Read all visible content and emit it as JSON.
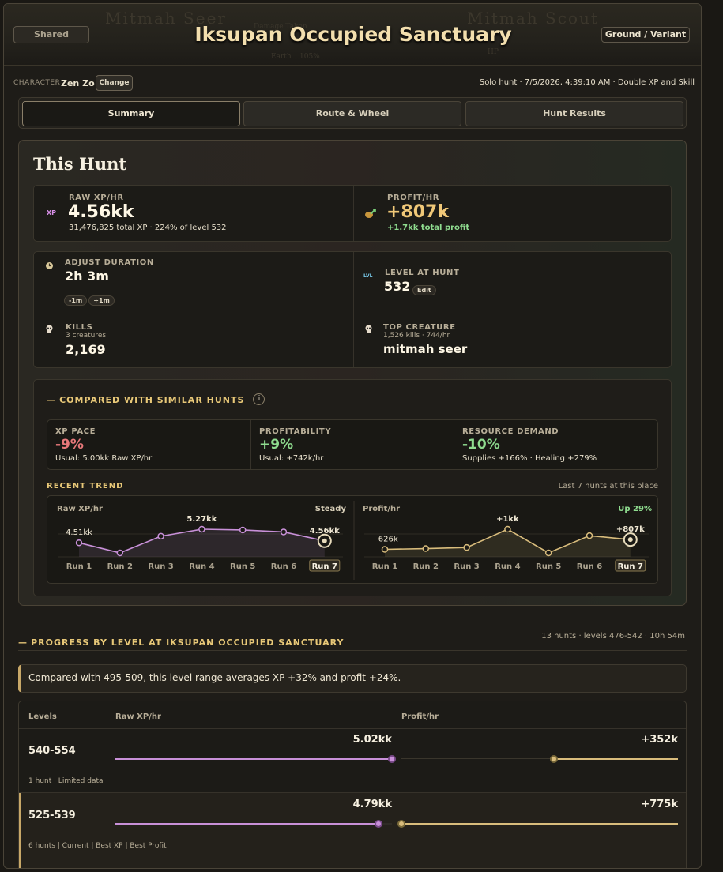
{
  "banner": {
    "shared_label": "Shared",
    "title": "Iksupan Occupied Sanctuary",
    "variant_label": "Ground / Variant",
    "ghost_left": "Mitmah Seer",
    "ghost_right": "Mitmah Scout",
    "ghost_small_1": "Damage Taken",
    "ghost_small_2": "Earth",
    "ghost_small_3": "105%",
    "ghost_small_4": "HP"
  },
  "character": {
    "label": "CHARACTER",
    "name": "Zen Zo",
    "change_label": "Change",
    "meta": "Solo hunt · 7/5/2026, 4:39:10 AM · Double XP and Skill"
  },
  "tabs": [
    {
      "label": "Summary",
      "active": true
    },
    {
      "label": "Route & Wheel",
      "active": false
    },
    {
      "label": "Hunt Results",
      "active": false
    }
  ],
  "hunt": {
    "title": "This Hunt",
    "raw_xp": {
      "icon": "XP",
      "label": "RAW XP/HR",
      "value": "4.56kk",
      "sub": "31,476,825 total XP · 224% of level 532"
    },
    "profit": {
      "icon": "money-bag-icon",
      "label": "PROFIT/HR",
      "value": "+807k",
      "sub": "+1.7kk total profit"
    },
    "duration": {
      "label": "ADJUST DURATION",
      "value": "2h 3m",
      "minus": "-1m",
      "plus": "+1m"
    },
    "level": {
      "icon": "LVL",
      "label": "LEVEL AT HUNT",
      "value": "532",
      "edit": "Edit"
    },
    "kills": {
      "label": "KILLS",
      "sub": "3 creatures",
      "value": "2,169"
    },
    "top_creature": {
      "label": "TOP CREATURE",
      "sub": "1,526 kills · 744/hr",
      "value": "mitmah seer"
    }
  },
  "compare": {
    "title": "COMPARED WITH SIMILAR HUNTS",
    "info": "i",
    "metrics": [
      {
        "label": "XP PACE",
        "value": "-9%",
        "tone": "red",
        "sub": "Usual: 5.00kk Raw XP/hr"
      },
      {
        "label": "PROFITABILITY",
        "value": "+9%",
        "tone": "green",
        "sub": "Usual: +742k/hr"
      },
      {
        "label": "RESOURCE DEMAND",
        "value": "-10%",
        "tone": "green",
        "sub": "Supplies +166% · Healing +279%"
      }
    ],
    "trend_title": "RECENT TREND",
    "trend_note": "Last 7 hunts at this place"
  },
  "chart_data": [
    {
      "type": "line",
      "title": "Raw XP/hr",
      "status": "Steady",
      "categories": [
        "Run 1",
        "Run 2",
        "Run 3",
        "Run 4",
        "Run 5",
        "Run 6",
        "Run 7"
      ],
      "values": [
        4.51,
        4.25,
        4.68,
        4.86,
        4.84,
        4.79,
        4.56
      ],
      "point_labels": [
        "4.51kk",
        "",
        "",
        "5.27kk",
        "",
        "",
        "4.56kk"
      ],
      "highlight_index": 6,
      "color": "#c890d8"
    },
    {
      "type": "line",
      "title": "Profit/hr",
      "status": "Up 29%",
      "categories": [
        "Run 1",
        "Run 2",
        "Run 3",
        "Run 4",
        "Run 5",
        "Run 6",
        "Run 7"
      ],
      "values": [
        626,
        640,
        660,
        1000,
        560,
        880,
        807
      ],
      "point_labels": [
        "+626k",
        "",
        "",
        "+1kk",
        "",
        "",
        "+807k"
      ],
      "highlight_index": 6,
      "color": "#d8bc7c"
    }
  ],
  "progress": {
    "title": "PROGRESS BY LEVEL AT IKSUPAN OCCUPIED SANCTUARY",
    "meta": "13 hunts · levels 476-542 · 10h 54m",
    "callout": "Compared with 495-509, this level range averages XP +32% and profit +24%.",
    "headers": {
      "levels": "Levels",
      "xp": "Raw XP/hr",
      "profit": "Profit/hr"
    },
    "rows": [
      {
        "levels": "540-554",
        "xp": "5.02kk",
        "xp_fill": 1.0,
        "profit": "+352k",
        "profit_fill": 0.45,
        "note": "1 hunt · Limited data",
        "current": false
      },
      {
        "levels": "525-539",
        "xp": "4.79kk",
        "xp_fill": 0.95,
        "profit": "+775k",
        "profit_fill": 1.0,
        "note": "6 hunts | Current | Best XP | Best Profit",
        "current": true
      }
    ]
  },
  "colors": {
    "accent": "#e8c878",
    "xp": "#c890d8",
    "profit": "#d8bc7c",
    "positive": "#8fdc8f",
    "negative": "#e8787a"
  }
}
